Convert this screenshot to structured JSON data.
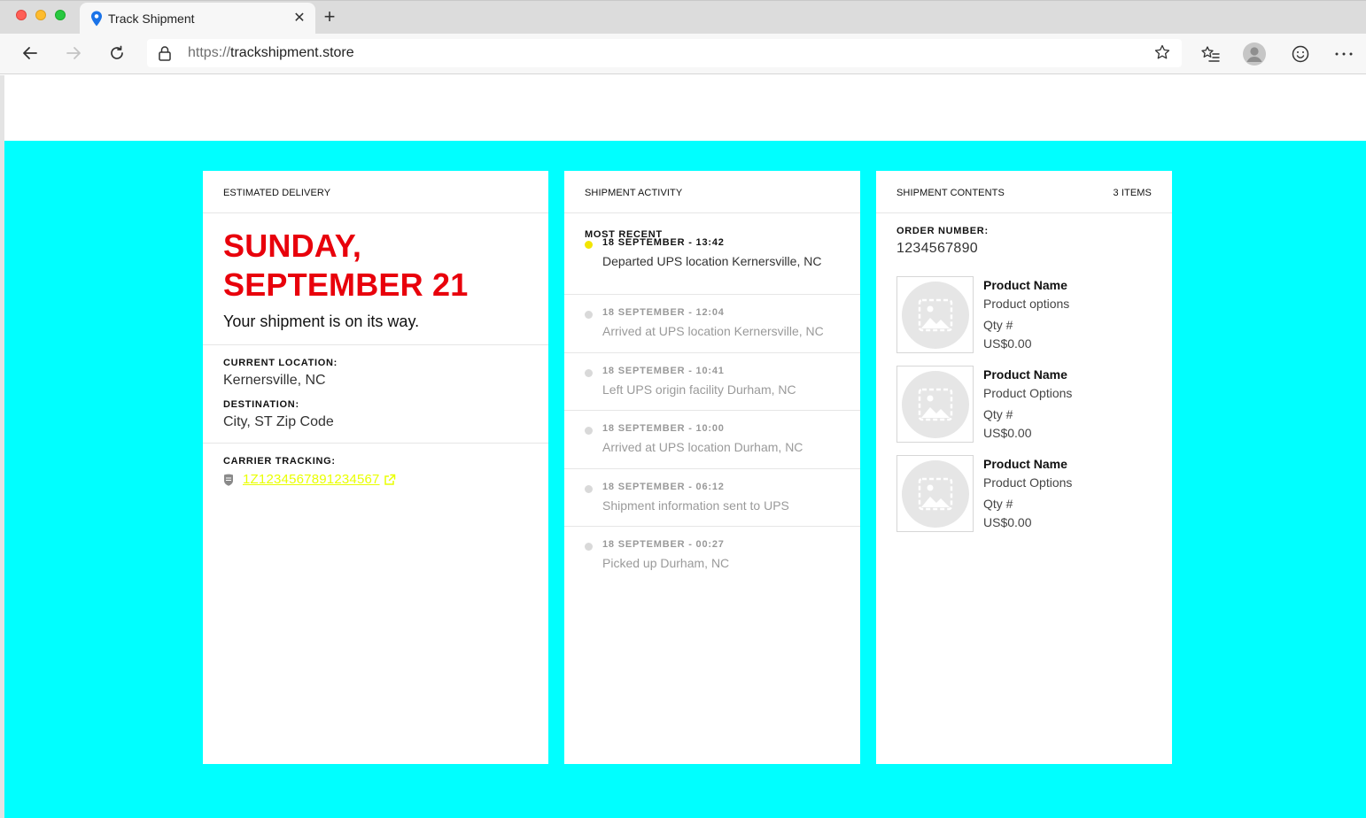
{
  "browser": {
    "tab_title": "Track Shipment",
    "url_scheme": "https://",
    "url_host": "trackshipment.store"
  },
  "colors": {
    "accent_red": "#e8000b",
    "page_background": "#00ffff",
    "link_yellow": "#e9ff00",
    "active_dot": "#f2e500"
  },
  "delivery": {
    "header": "ESTIMATED DELIVERY",
    "date_line1": "SUNDAY,",
    "date_line2": "SEPTEMBER 21",
    "message": "Your shipment is on its way.",
    "current_location_label": "CURRENT LOCATION:",
    "current_location": "Kernersville, NC",
    "destination_label": "DESTINATION:",
    "destination": "City, ST Zip Code",
    "carrier_label": "CARRIER TRACKING:",
    "tracking_number": "1Z1234567891234567"
  },
  "activity": {
    "header": "SHIPMENT ACTIVITY",
    "most_recent_label": "MOST RECENT",
    "events": [
      {
        "time": "18 SEPTEMBER - 13:42",
        "desc": "Departed UPS location Kernersville, NC"
      },
      {
        "time": "18 SEPTEMBER - 12:04",
        "desc": "Arrived at UPS location Kernersville, NC"
      },
      {
        "time": "18 SEPTEMBER - 10:41",
        "desc": "Left UPS origin facility Durham, NC"
      },
      {
        "time": "18 SEPTEMBER - 10:00",
        "desc": "Arrived at UPS location Durham, NC"
      },
      {
        "time": "18 SEPTEMBER - 06:12",
        "desc": "Shipment information sent to UPS"
      },
      {
        "time": "18 SEPTEMBER - 00:27",
        "desc": "Picked up Durham, NC"
      }
    ]
  },
  "contents": {
    "header": "SHIPMENT CONTENTS",
    "item_count": "3 ITEMS",
    "order_label": "ORDER NUMBER:",
    "order_number": "1234567890",
    "products": [
      {
        "name": "Product Name",
        "options": "Product options",
        "qty": "Qty #",
        "price": "US$0.00"
      },
      {
        "name": "Product Name",
        "options": "Product Options",
        "qty": "Qty #",
        "price": "US$0.00"
      },
      {
        "name": "Product Name",
        "options": "Product Options",
        "qty": "Qty #",
        "price": "US$0.00"
      }
    ]
  }
}
